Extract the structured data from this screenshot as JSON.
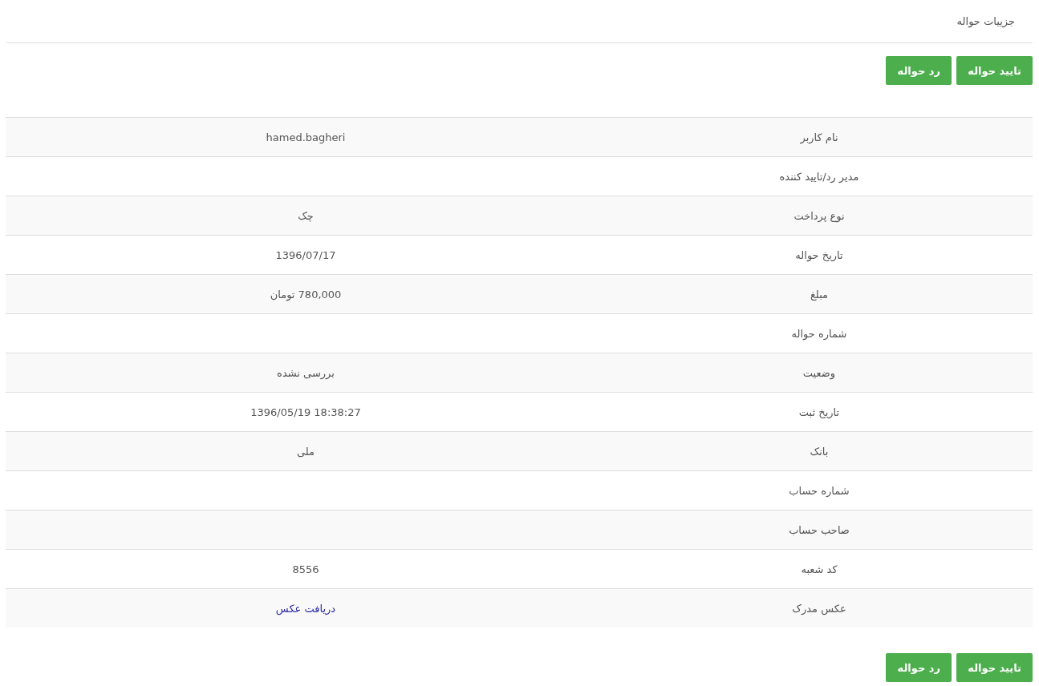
{
  "page_title": "جزییات حواله",
  "top_actions": [
    {
      "label": "تایید حواله"
    },
    {
      "label": "رد حواله"
    }
  ],
  "details": [
    {
      "label": "نام کاربر",
      "kind": "text",
      "value": "hamed.bagheri"
    },
    {
      "label": "مدیر رد/تایید کننده"
    },
    {
      "label": "نوع پرداخت",
      "kind": "text",
      "value": "چک"
    },
    {
      "label": "تاریخ حواله",
      "kind": "text",
      "value": "1396/07/17"
    },
    {
      "label": "مبلغ",
      "kind": "text",
      "value": "780,000 تومان"
    },
    {
      "label": "شماره حواله"
    },
    {
      "label": "وضعیت",
      "kind": "text",
      "value": "بررسی نشده"
    },
    {
      "label": "تاریخ ثبت",
      "kind": "text",
      "value": "1396/05/19  18:38:27"
    },
    {
      "label": "بانک",
      "kind": "text",
      "value": "ملی"
    },
    {
      "label": "شماره حساب"
    },
    {
      "label": "صاحب حساب"
    },
    {
      "label": "کد شعبه",
      "kind": "text",
      "value": "8556"
    },
    {
      "label": "عکس مدرک",
      "kind": "link",
      "value": "دریافت عکس"
    }
  ],
  "bottom_actions": [
    {
      "label": "تایید حواله"
    },
    {
      "label": "رد حواله"
    }
  ]
}
